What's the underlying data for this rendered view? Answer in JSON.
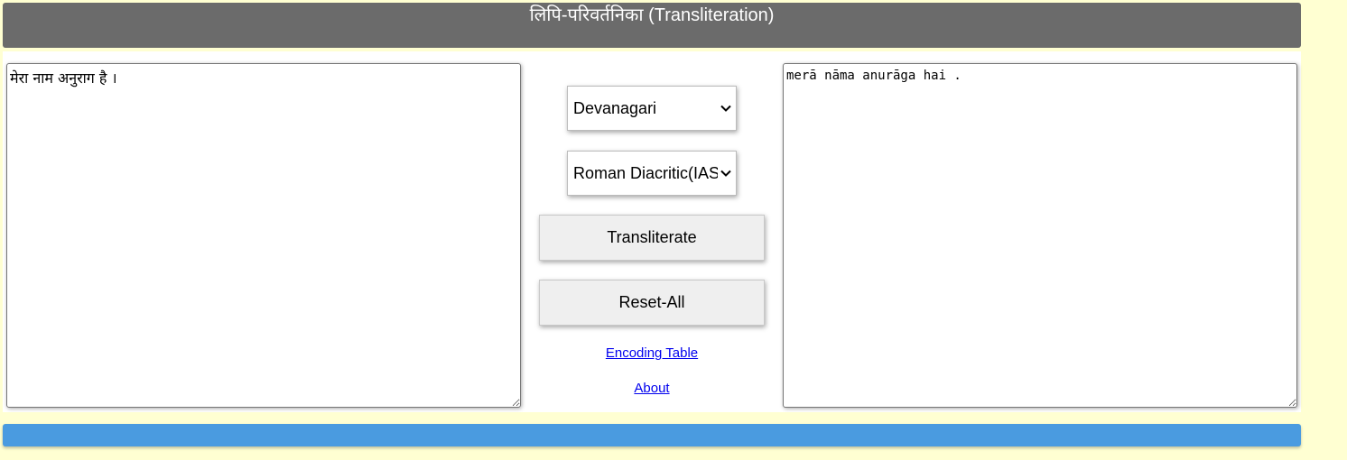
{
  "header": {
    "title": "लिपि-परिवर्तनिका (Transliteration)"
  },
  "input": {
    "value": "मेरा नाम अनुराग है ।"
  },
  "output": {
    "value": "merā nāma anurāga hai ."
  },
  "controls": {
    "source_script": "Devanagari",
    "target_script": "Roman Diacritic(IAST)",
    "transliterate_label": "Transliterate",
    "reset_label": "Reset-All",
    "encoding_table_link": "Encoding Table",
    "about_link": "About"
  },
  "icons": {
    "dropdown": "chevron-down-icon",
    "resize": "resize-grip-icon"
  },
  "colors": {
    "page_background": "#ffffd2",
    "header_background": "#6b6b6b",
    "footer_bar": "#4a9be0",
    "link": "#0000ee"
  }
}
